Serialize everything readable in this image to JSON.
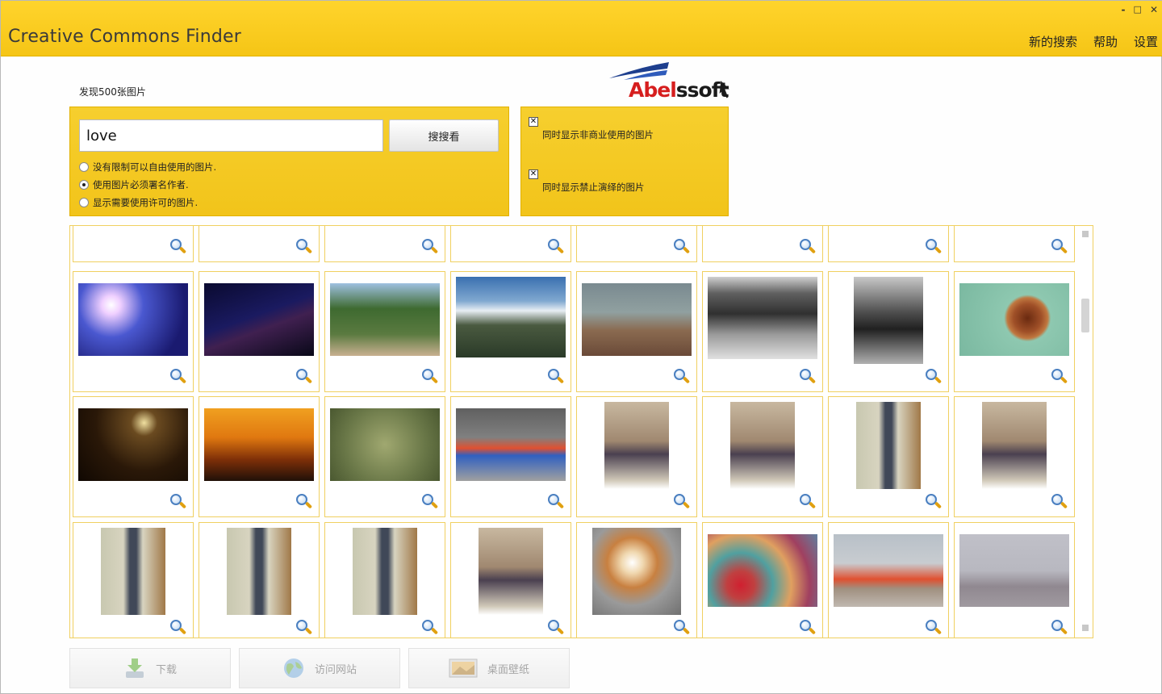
{
  "window": {
    "title": "Creative Commons Finder",
    "controls": {
      "minimize": "-",
      "restore": "□",
      "close": "✕"
    },
    "menu": [
      "新的搜索",
      "帮助",
      "设置"
    ]
  },
  "logo": {
    "part_a": "Abel",
    "part_b": "ssoft"
  },
  "results": {
    "count_label": "发现500张图片"
  },
  "search": {
    "query": "love",
    "button_label": "搜搜看",
    "license_options": [
      {
        "label": "没有限制可以自由使用的图片.",
        "selected": false
      },
      {
        "label": "使用图片必须署名作者.",
        "selected": true
      },
      {
        "label": "显示需要使用许可的图片.",
        "selected": false
      }
    ]
  },
  "filters": [
    {
      "label": "同时显示非商业使用的图片",
      "checked": true,
      "mark": "✕"
    },
    {
      "label": "同时显示禁止演绎的图片",
      "checked": true,
      "mark": "✕"
    }
  ],
  "thumbnails": {
    "row0": [
      "party-blue",
      "blue-night",
      "dark-blue",
      "black-strip",
      "blue-concert",
      "blue-stage",
      "black-strip",
      "blue-red"
    ],
    "row1": [
      "party-crowd",
      "lightning-night",
      "feet-forest",
      "mountain-lake",
      "hazy-field",
      "bw-street",
      "bw-child",
      "nut-bowl"
    ],
    "row2": [
      "dark-room-lamp",
      "sunset-couple",
      "grass-macro",
      "street-crowd",
      "man-on-sofa",
      "man-on-sofa",
      "man-in-room",
      "man-on-sofa"
    ],
    "row3": [
      "man-in-room",
      "man-in-room",
      "man-in-room",
      "man-on-sofa",
      "corgi-puppy",
      "love-locks",
      "city-promenade",
      "hazy-skyline"
    ]
  },
  "bottom_buttons": {
    "download": "下载",
    "visit_site": "访问网站",
    "wallpaper": "桌面壁纸"
  },
  "colors": {
    "accent": "#f5c516",
    "tile_border": "#f0d060",
    "logo_red": "#d61e1e"
  }
}
